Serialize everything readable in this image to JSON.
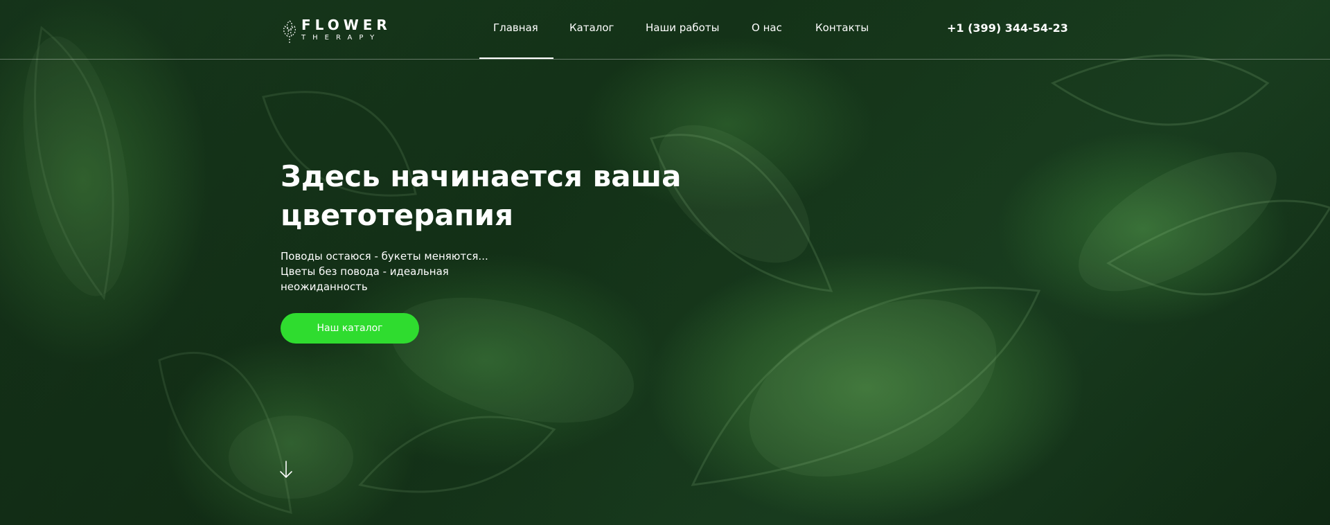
{
  "header": {
    "logo": {
      "word": "FLOWER",
      "sub": "THERAPY"
    },
    "nav": [
      {
        "label": "Главная",
        "active": true
      },
      {
        "label": "Каталог",
        "active": false
      },
      {
        "label": "Наши работы",
        "active": false
      },
      {
        "label": "О нас",
        "active": false
      },
      {
        "label": "Контакты",
        "active": false
      }
    ],
    "phone": "+1 (399) 344-54-23"
  },
  "hero": {
    "title_line1": "Здесь начинается ваша",
    "title_line2": "цветотерапия",
    "text_line1": "Поводы остаюся - букеты меняются...",
    "text_line2": "Цветы без повода - идеальная",
    "text_line3": "неожиданность",
    "cta_label": "Наш каталог"
  },
  "icons": {
    "logo": "flower-outline-icon",
    "scroll": "arrow-down-icon"
  },
  "colors": {
    "accent": "#2fdc2f",
    "text": "#ffffff",
    "background": "#1a3f20"
  }
}
